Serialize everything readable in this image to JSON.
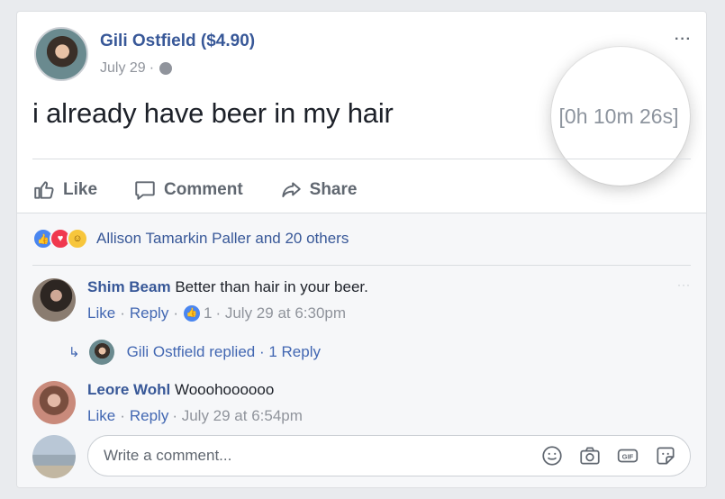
{
  "post": {
    "author": "Gili Ostfield ($4.90)",
    "date": "July 29",
    "date_sep": "·",
    "text": "i already have beer in my hair",
    "timer": "[0h 10m 26s]",
    "more": "···"
  },
  "actions": {
    "like": "Like",
    "comment": "Comment",
    "share": "Share"
  },
  "reactions": {
    "summary": "Allison Tamarkin Paller and 20 others"
  },
  "comments": [
    {
      "name": "Shim Beam",
      "text": "Better than hair in your beer.",
      "like": "Like",
      "sep1": "·",
      "reply": "Reply",
      "sep2": "·",
      "likes": "1",
      "meta": "· July 29 at 6:30pm",
      "more": "···"
    },
    {
      "name": "Leore Wohl",
      "text": "Wooohoooooo",
      "like": "Like",
      "sep1": "·",
      "reply": "Reply",
      "meta": "· July 29 at 6:54pm"
    }
  ],
  "reply_summary": {
    "text": "Gili Ostfield replied · 1 Reply"
  },
  "composer": {
    "placeholder": "Write a comment..."
  }
}
